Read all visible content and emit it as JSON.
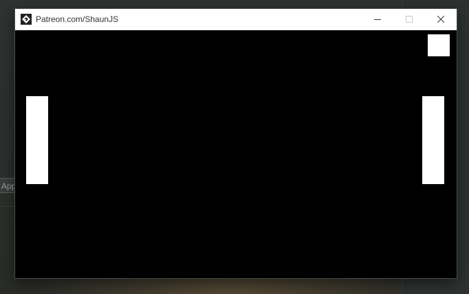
{
  "background": {
    "app_chip_label": "App"
  },
  "window": {
    "title": "Patreon.com/ShaunJS",
    "icon": "gamemaker-icon",
    "controls": {
      "minimize_icon": "minimize-icon",
      "maximize_icon": "maximize-icon",
      "close_icon": "close-icon"
    }
  },
  "game": {
    "type": "pong",
    "background_color": "#000000",
    "object_color": "#ffffff",
    "objects": [
      {
        "name": "left-paddle",
        "shape": "rectangle"
      },
      {
        "name": "right-paddle",
        "shape": "rectangle"
      },
      {
        "name": "ball",
        "shape": "square"
      }
    ]
  }
}
